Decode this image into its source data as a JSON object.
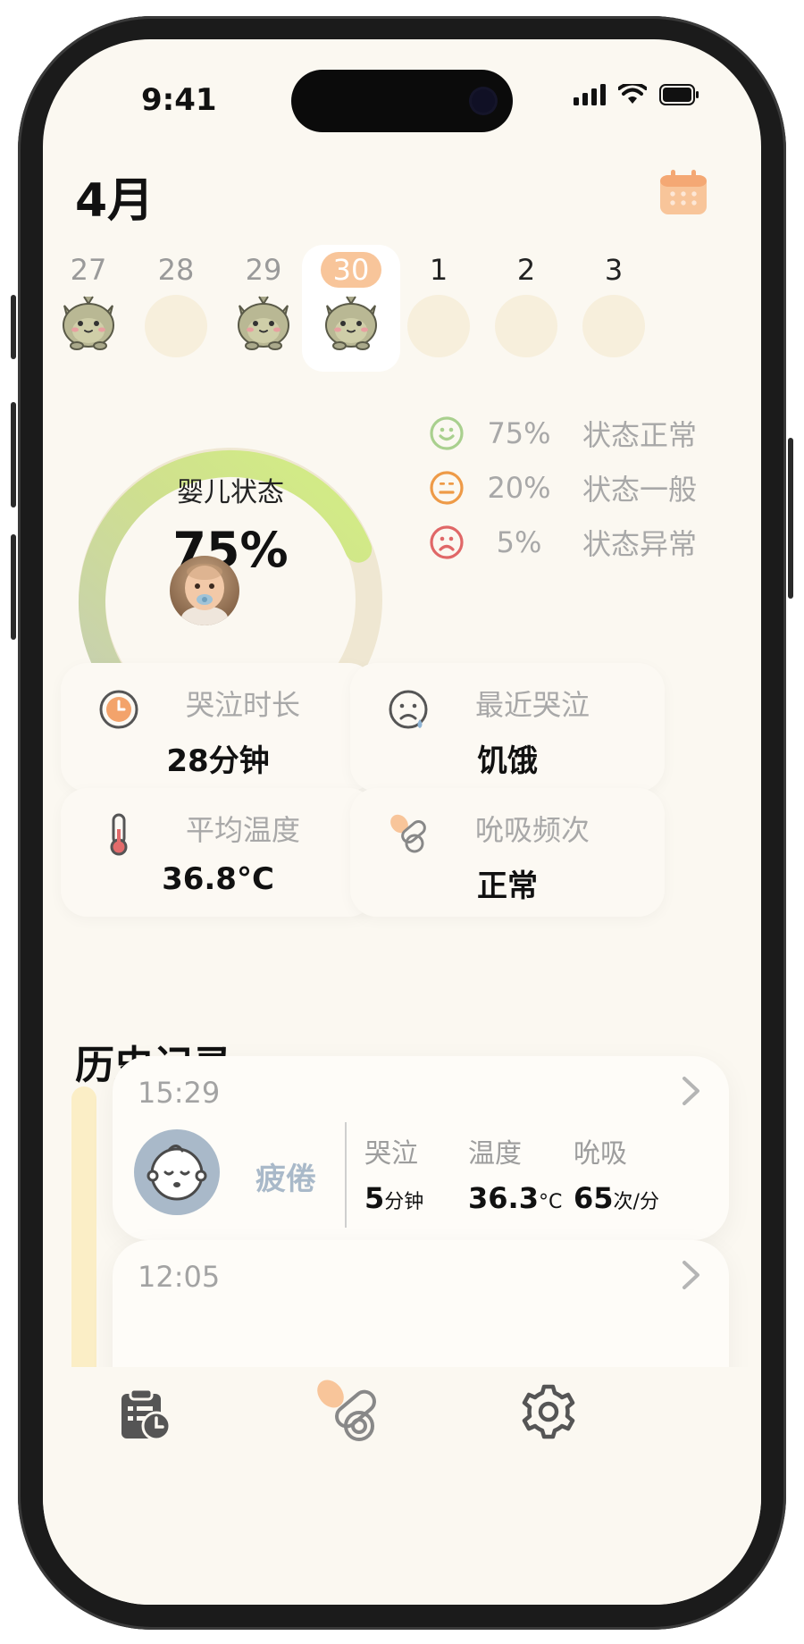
{
  "status": {
    "time": "9:41"
  },
  "header": {
    "month": "4月"
  },
  "week": [
    {
      "num": "27",
      "mood": "monster"
    },
    {
      "num": "28",
      "mood": "empty"
    },
    {
      "num": "29",
      "mood": "monster"
    },
    {
      "num": "30",
      "mood": "monster",
      "selected": true
    },
    {
      "num": "1",
      "mood": "empty"
    },
    {
      "num": "2",
      "mood": "empty"
    },
    {
      "num": "3",
      "mood": "empty"
    }
  ],
  "gauge": {
    "label": "婴儿状态",
    "value_text": "75%",
    "value": 0.75
  },
  "legend": [
    {
      "pct": "75%",
      "label": "状态正常",
      "color": "#a9d08e",
      "icon": "smile-icon"
    },
    {
      "pct": "20%",
      "label": "状态一般",
      "color": "#ee9a47",
      "icon": "neutral-face-icon"
    },
    {
      "pct": "5%",
      "label": "状态异常",
      "color": "#e06767",
      "icon": "sad-face-icon"
    }
  ],
  "stats": {
    "cry_duration": {
      "title": "哭泣时长",
      "value": "28分钟"
    },
    "last_cry": {
      "title": "最近哭泣",
      "value": "饥饿"
    },
    "avg_temp": {
      "title": "平均温度",
      "value": "36.8°C"
    },
    "suck_freq": {
      "title": "吮吸频次",
      "value": "正常"
    }
  },
  "history": {
    "title": "历史记录",
    "records": [
      {
        "time": "15:29",
        "state": "疲倦",
        "cry_label": "哭泣",
        "cry_value": "5",
        "cry_unit": "分钟",
        "temp_label": "温度",
        "temp_value": "36.3",
        "temp_unit": "°C",
        "suck_label": "吮吸",
        "suck_value": "65",
        "suck_unit": "次/分"
      },
      {
        "time": "12:05"
      }
    ]
  },
  "colors": {
    "background": "#fbf8f1",
    "accent": "#f8c59a",
    "gauge_green": "#cde68a",
    "gauge_track": "#efe7d2"
  }
}
